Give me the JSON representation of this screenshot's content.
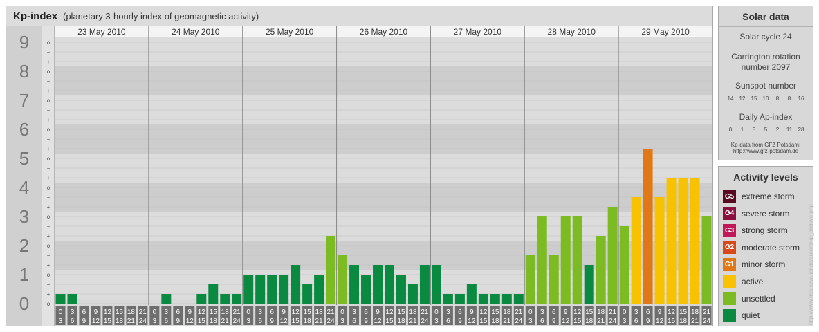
{
  "title": "Kp-index",
  "subtitle": "(planetary 3-hourly index of geomagnetic activity)",
  "chart_data": {
    "type": "bar",
    "title": "Kp-index",
    "subtitle": "(planetary 3-hourly index of geomagnetic activity)",
    "ylim": [
      0,
      9
    ],
    "y_ticks": [
      "0",
      "1",
      "2",
      "3",
      "4",
      "5",
      "6",
      "7",
      "8",
      "9"
    ],
    "y_minor_marks": [
      "o",
      "+",
      "−"
    ],
    "days": [
      "23 May 2010",
      "24 May 2010",
      "25 May 2010",
      "26 May 2010",
      "27 May 2010",
      "28 May 2010",
      "29 May 2010"
    ],
    "hour_start": [
      "0",
      "3",
      "6",
      "9",
      "12",
      "15",
      "18",
      "21"
    ],
    "hour_end": [
      "3",
      "6",
      "9",
      "12",
      "15",
      "18",
      "21",
      "24"
    ],
    "values": [
      0.333,
      0.333,
      0,
      0,
      0,
      0,
      0,
      0,
      0,
      0.333,
      0,
      0,
      0.333,
      0.667,
      0.333,
      0.333,
      1,
      1,
      1,
      1,
      1.333,
      0.667,
      1,
      2.333,
      1.667,
      1.333,
      1,
      1.333,
      1.333,
      1,
      0.667,
      1.333,
      1.333,
      0.333,
      0.333,
      0.667,
      0.333,
      0.333,
      0.333,
      0.333,
      1.667,
      3,
      1.667,
      3,
      3,
      1.333,
      2.333,
      3.333,
      2.667,
      3.667,
      5.333,
      3.667,
      4.333,
      4.333,
      4.333,
      3
    ],
    "colors": {
      "quiet": "#0a8a40",
      "unsettled": "#7dbb22",
      "active": "#f8c200",
      "minor_storm": "#e07818"
    }
  },
  "solar": {
    "title": "Solar data",
    "cycle": "Solar cycle 24",
    "carrington_line1": "Carrington rotation",
    "carrington_line2": "number 2097",
    "sunspot_title": "Sunspot number",
    "sunspot_values": [
      "14",
      "12",
      "15",
      "10",
      "8",
      "8",
      "16"
    ],
    "ap_title": "Daily Ap-index",
    "ap_values": [
      "0",
      "1",
      "5",
      "5",
      "2",
      "11",
      "28"
    ],
    "source_line1": "Kp-data from GFZ Potsdam:",
    "source_line2": "http://www.gfz-potsdam.de"
  },
  "activity": {
    "title": "Activity levels",
    "levels": [
      {
        "badge": "G5",
        "label": "extreme storm",
        "color": "#5a0a20"
      },
      {
        "badge": "G4",
        "label": "severe storm",
        "color": "#8a1040"
      },
      {
        "badge": "G3",
        "label": "strong storm",
        "color": "#c01858"
      },
      {
        "badge": "G2",
        "label": "moderate storm",
        "color": "#d84818"
      },
      {
        "badge": "G1",
        "label": "minor storm",
        "color": "#e07818"
      },
      {
        "badge": "",
        "label": "active",
        "color": "#f8c200"
      },
      {
        "badge": "",
        "label": "unsettled",
        "color": "#7dbb22"
      },
      {
        "badge": "",
        "label": "quiet",
        "color": "#0a8a40"
      }
    ]
  },
  "credit": "http://www.theusewuler.de/aurora/kp_archive.php"
}
